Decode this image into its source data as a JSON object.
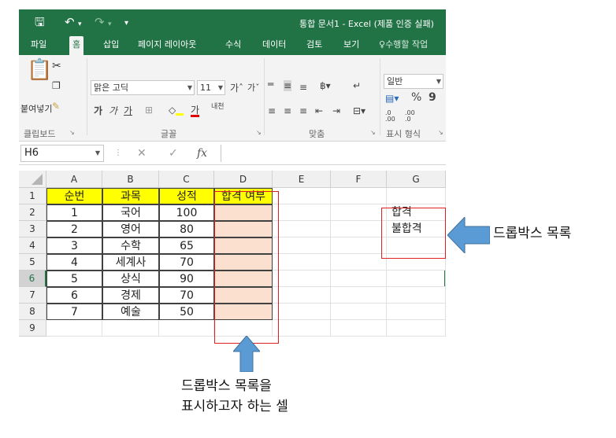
{
  "window": {
    "title": "통합 문서1 - Excel (제품 인증 실패)",
    "qat": {
      "save_icon": "floppy-disk-icon",
      "undo_icon": "undo-icon",
      "redo_icon": "redo-icon",
      "customize_icon": "dropdown-icon"
    }
  },
  "tabs": [
    "파일",
    "홈",
    "삽입",
    "페이지 레이아웃",
    "수식",
    "데이터",
    "검토",
    "보기"
  ],
  "tell_me": "수행할 작업",
  "ribbon": {
    "clipboard": {
      "paste": "붙여넣기",
      "group": "클립보드"
    },
    "font": {
      "name": "맑은 고딕",
      "size": "11",
      "grow": "가",
      "shrink": "가",
      "bold": "가",
      "italic": "가",
      "underline": "가",
      "font_color_letter": "가",
      "phonetic": "내천",
      "group": "글꼴"
    },
    "alignment": {
      "group": "맞춤"
    },
    "number": {
      "format": "일반",
      "percent": "%",
      "comma": "9",
      "inc_decimal": ".0 .00",
      "dec_decimal": ".00 .0",
      "group": "표시 형식"
    }
  },
  "formula_bar": {
    "name_box": "H6",
    "fx": "fx",
    "value": ""
  },
  "grid": {
    "columns": [
      "A",
      "B",
      "C",
      "D",
      "E",
      "F",
      "G"
    ],
    "rows": [
      "1",
      "2",
      "3",
      "4",
      "5",
      "6",
      "7",
      "8",
      "9"
    ],
    "selected_row": "6",
    "headers": [
      "순번",
      "과목",
      "성적",
      "합격 여부"
    ],
    "data": [
      [
        "1",
        "국어",
        "100",
        ""
      ],
      [
        "2",
        "영어",
        "80",
        ""
      ],
      [
        "3",
        "수학",
        "65",
        ""
      ],
      [
        "4",
        "세계사",
        "70",
        ""
      ],
      [
        "5",
        "상식",
        "90",
        ""
      ],
      [
        "6",
        "경제",
        "70",
        ""
      ],
      [
        "7",
        "예술",
        "50",
        ""
      ]
    ],
    "g_list": [
      "합격",
      "불합격"
    ]
  },
  "annotations": {
    "right_label": "드롭박스 목록",
    "bottom_line1": "드롭박스 목록을",
    "bottom_line2": "표시하고자 하는 셀",
    "arrow_color": "#5b9bd5",
    "box_color": "#e02020"
  },
  "colors": {
    "excel_green": "#217346",
    "header_yellow": "#ffff00",
    "target_fill": "#fbe0d0"
  }
}
